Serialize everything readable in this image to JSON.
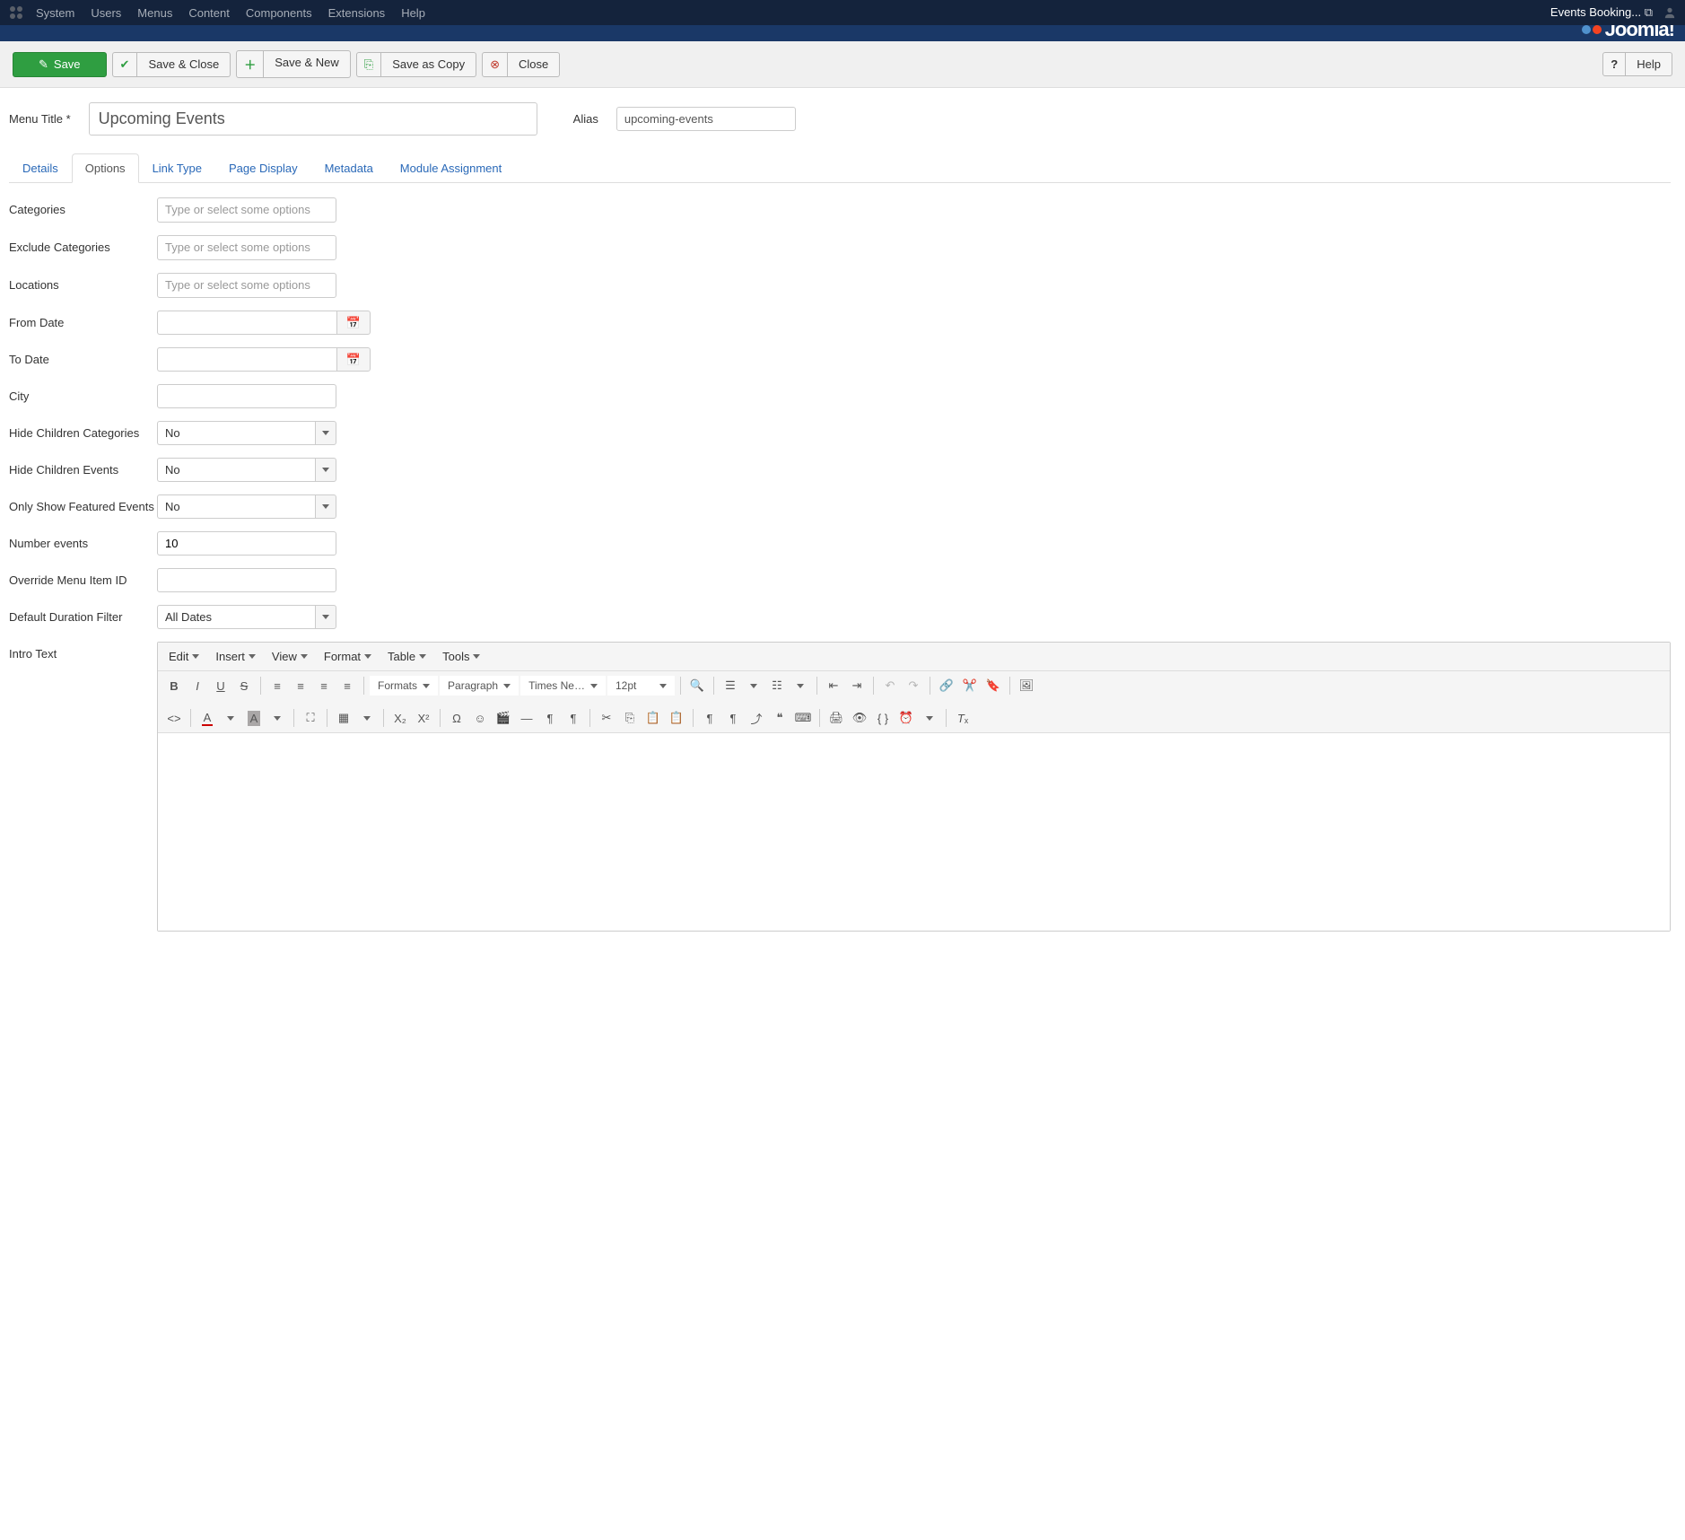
{
  "topbar": {
    "menu": [
      "System",
      "Users",
      "Menus",
      "Content",
      "Components",
      "Extensions",
      "Help"
    ],
    "site_name": "Events Booking..."
  },
  "toolbar": {
    "save": "Save",
    "save_close": "Save & Close",
    "save_new": "Save & New",
    "save_copy": "Save as Copy",
    "close": "Close",
    "help": "Help"
  },
  "form": {
    "menu_title_label": "Menu Title *",
    "menu_title_value": "Upcoming Events",
    "alias_label": "Alias",
    "alias_value": "upcoming-events"
  },
  "tabs": [
    "Details",
    "Options",
    "Link Type",
    "Page Display",
    "Metadata",
    "Module Assignment"
  ],
  "active_tab": "Options",
  "fields": {
    "categories": {
      "label": "Categories",
      "placeholder": "Type or select some options"
    },
    "exclude_categories": {
      "label": "Exclude Categories",
      "placeholder": "Type or select some options"
    },
    "locations": {
      "label": "Locations",
      "placeholder": "Type or select some options"
    },
    "from_date": {
      "label": "From Date",
      "value": ""
    },
    "to_date": {
      "label": "To Date",
      "value": ""
    },
    "city": {
      "label": "City",
      "value": ""
    },
    "hide_children_categories": {
      "label": "Hide Children Categories",
      "value": "No"
    },
    "hide_children_events": {
      "label": "Hide Children Events",
      "value": "No"
    },
    "only_featured": {
      "label": "Only Show Featured Events",
      "value": "No"
    },
    "number_events": {
      "label": "Number events",
      "value": "10"
    },
    "override_menu_id": {
      "label": "Override Menu Item ID",
      "value": ""
    },
    "default_duration": {
      "label": "Default Duration Filter",
      "value": "All Dates"
    },
    "intro_text": {
      "label": "Intro Text"
    }
  },
  "editor": {
    "menubar": [
      "Edit",
      "Insert",
      "View",
      "Format",
      "Table",
      "Tools"
    ],
    "formats": "Formats",
    "block": "Paragraph",
    "font": "Times Ne…",
    "size": "12pt"
  }
}
